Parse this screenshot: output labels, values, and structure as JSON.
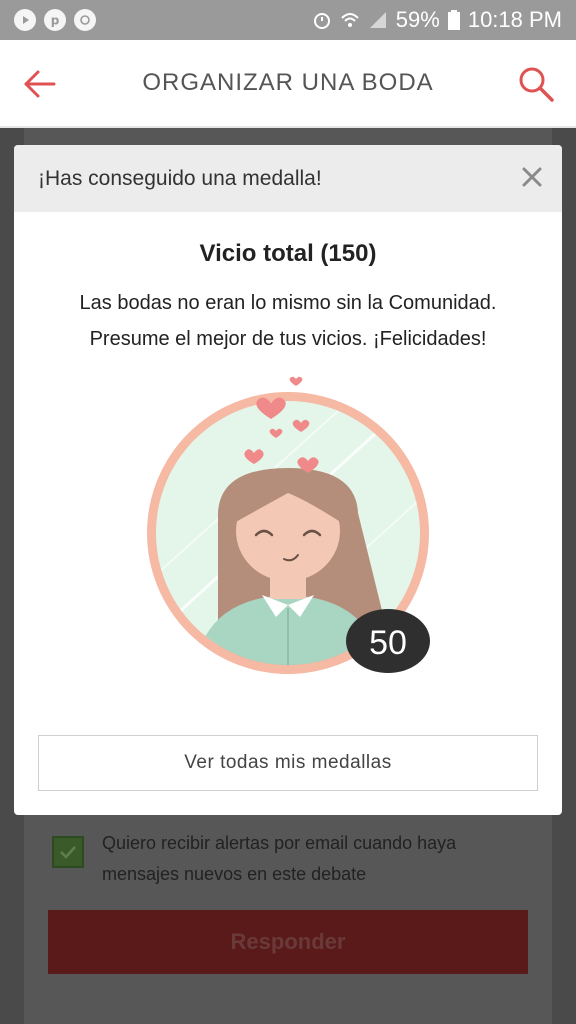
{
  "status_bar": {
    "battery": "59%",
    "time": "10:18 PM"
  },
  "header": {
    "title": "ORGANIZAR UNA BODA"
  },
  "background_page": {
    "checkbox_label": "Quiero recibir alertas por email cuando haya mensajes nuevos en este debate",
    "reply_button": "Responder"
  },
  "modal": {
    "title": "¡Has conseguido una medalla!",
    "medal_name": "Vicio total (150)",
    "description": "Las bodas no eran lo mismo sin la Comunidad. Presume el mejor de tus vicios. ¡Felicidades!",
    "badge_number": "50",
    "view_all_button": "Ver todas mis medallas"
  },
  "colors": {
    "accent": "#e05252",
    "medal_ring": "#f6b9a3",
    "medal_bg": "#e4f6ea",
    "hair": "#b58d7b",
    "sweater": "#a9d6c3",
    "badge_bg": "#2f2f2f"
  },
  "icons": {
    "back": "arrow-left-icon",
    "search": "magnifier-icon",
    "close": "close-icon"
  }
}
